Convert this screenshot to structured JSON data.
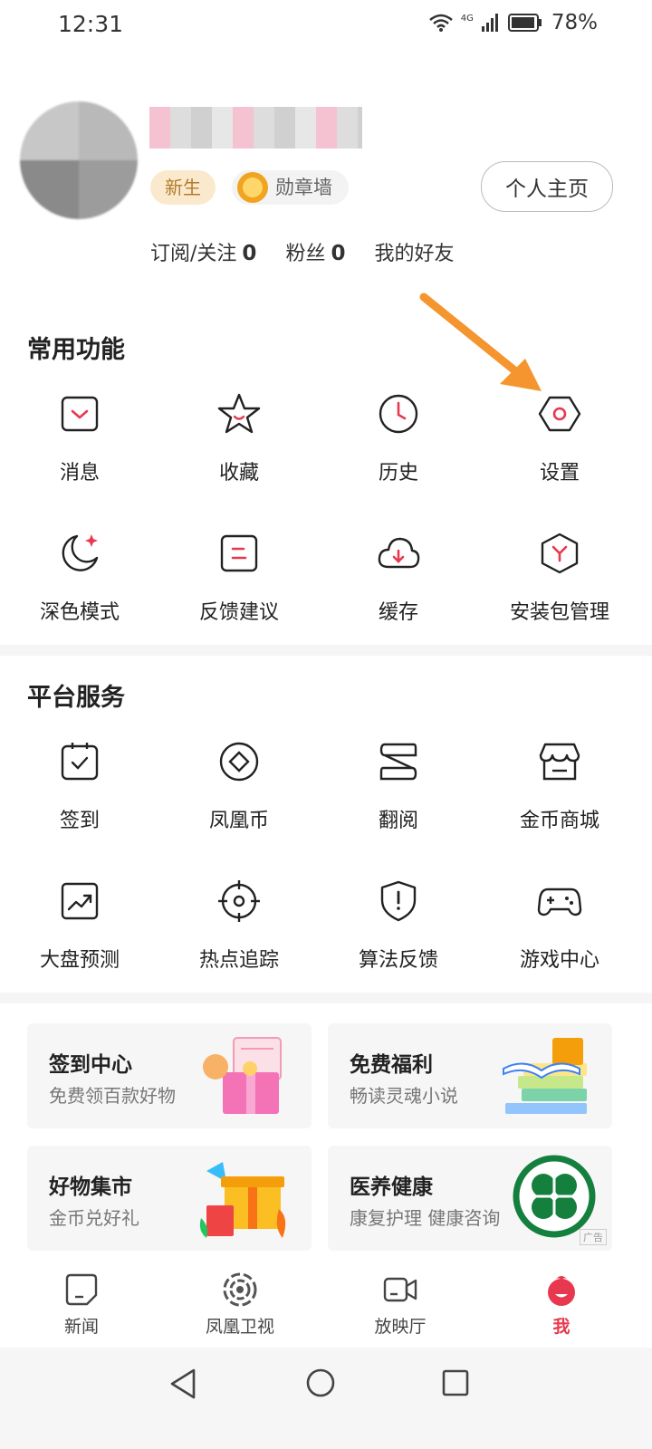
{
  "status_bar": {
    "time": "12:31",
    "network": "4G",
    "battery": "78%"
  },
  "profile": {
    "badge_new": "新生",
    "badge_medal": "勋章墙",
    "profile_button": "个人主页",
    "subscribe_label": "订阅/关注",
    "subscribe_count": "0",
    "fans_label": "粉丝",
    "fans_count": "0",
    "friends_label": "我的好友"
  },
  "common": {
    "title": "常用功能",
    "items": [
      {
        "label": "消息",
        "icon": "message-icon"
      },
      {
        "label": "收藏",
        "icon": "star-icon"
      },
      {
        "label": "历史",
        "icon": "clock-icon"
      },
      {
        "label": "设置",
        "icon": "settings-hexagon-icon"
      },
      {
        "label": "深色模式",
        "icon": "moon-icon"
      },
      {
        "label": "反馈建议",
        "icon": "feedback-icon"
      },
      {
        "label": "缓存",
        "icon": "cloud-download-icon"
      },
      {
        "label": "安装包管理",
        "icon": "package-icon"
      }
    ]
  },
  "platform": {
    "title": "平台服务",
    "items": [
      {
        "label": "签到",
        "icon": "checkin-icon"
      },
      {
        "label": "凤凰币",
        "icon": "coin-icon"
      },
      {
        "label": "翻阅",
        "icon": "pages-icon"
      },
      {
        "label": "金币商城",
        "icon": "store-icon"
      },
      {
        "label": "大盘预测",
        "icon": "trend-chart-icon"
      },
      {
        "label": "热点追踪",
        "icon": "target-icon"
      },
      {
        "label": "算法反馈",
        "icon": "shield-alert-icon"
      },
      {
        "label": "游戏中心",
        "icon": "gamepad-icon"
      }
    ]
  },
  "cards": [
    {
      "title": "签到中心",
      "subtitle": "免费领百款好物",
      "illustration": "gift-box-illustration"
    },
    {
      "title": "免费福利",
      "subtitle": "畅读灵魂小说",
      "illustration": "books-illustration"
    },
    {
      "title": "好物集市",
      "subtitle": "金币兑好礼",
      "illustration": "present-illustration"
    },
    {
      "title": "医养健康",
      "subtitle": "康复护理 健康咨询",
      "illustration": "clover-logo",
      "ad_tag": "广告"
    }
  ],
  "bottom_nav": [
    {
      "label": "新闻",
      "icon": "news-icon",
      "active": false
    },
    {
      "label": "凤凰卫视",
      "icon": "phoenix-logo-icon",
      "active": false
    },
    {
      "label": "放映厅",
      "icon": "video-camera-icon",
      "active": false
    },
    {
      "label": "我",
      "icon": "me-mascot-icon",
      "active": true
    }
  ],
  "colors": {
    "accent": "#e8384f",
    "active_tab": "#e8384f",
    "annotation_arrow": "#f5952f"
  }
}
